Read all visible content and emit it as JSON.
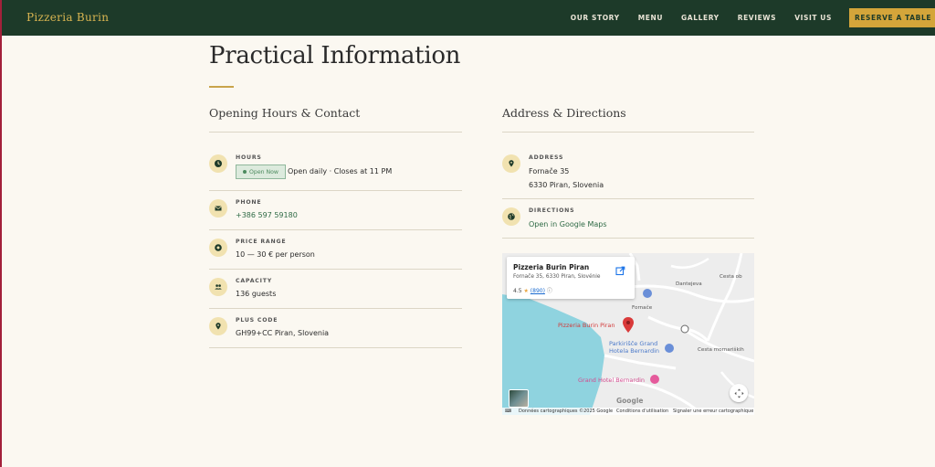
{
  "nav": {
    "brand": "Pizzeria Burin",
    "links": [
      "OUR STORY",
      "MENU",
      "GALLERY",
      "REVIEWS",
      "VISIT US"
    ],
    "cta": "RESERVE A TABLE"
  },
  "page": {
    "title": "Practical Information"
  },
  "contact": {
    "title": "Opening Hours & Contact",
    "hours": {
      "label": "HOURS",
      "badge": "Open Now",
      "value": "Open daily · Closes at 11 PM"
    },
    "phone": {
      "label": "PHONE",
      "value": "+386 597 59180"
    },
    "price": {
      "label": "PRICE RANGE",
      "value": "10 — 30 € per person"
    },
    "capacity": {
      "label": "CAPACITY",
      "value": "136 guests"
    },
    "plus": {
      "label": "PLUS CODE",
      "value": "GH99+CC Piran, Slovenia"
    }
  },
  "address": {
    "title": "Address & Directions",
    "addr": {
      "label": "ADDRESS",
      "line1": "Fornače 35",
      "line2": "6330 Piran, Slovenia"
    },
    "directions": {
      "label": "DIRECTIONS",
      "value": "Open in Google Maps"
    }
  },
  "map": {
    "card_title": "Pizzeria Burin Piran",
    "card_address": "Fornače 35, 6330 Piran, Slovénie",
    "rating": "4.5",
    "reviews": "(890)",
    "pin_label": "Pizzeria Burin Piran",
    "poi_parking": "Parkirišče Grand\nHotela Bernardin",
    "poi_hotel": "Grand Hotel Bernardin",
    "street_1": "Cesta mornariških",
    "street_2": "Cesta ob",
    "street_3": "Fornače",
    "street_4": "Dantejeva",
    "logo": "Google",
    "footer_data": "Données cartographiques ©2025 Google",
    "footer_terms": "Conditions d'utilisation",
    "footer_report": "Signaler une erreur cartographique"
  },
  "colors": {
    "header_bg": "#1d3a29",
    "accent": "#d4a53a",
    "page_bg": "#fbf8f1",
    "link_green": "#2e6a45"
  }
}
